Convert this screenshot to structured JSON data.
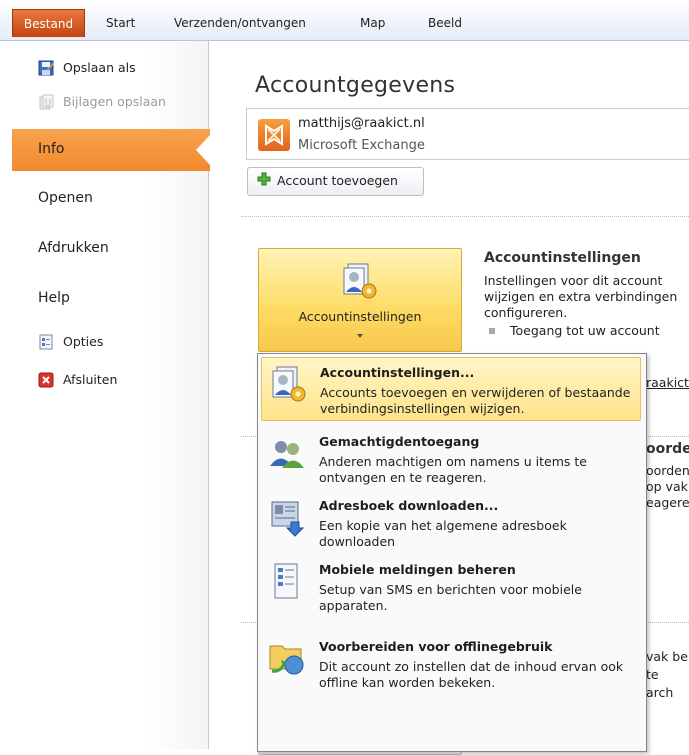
{
  "ribbon": {
    "tabs": [
      "Bestand",
      "Start",
      "Verzenden/ontvangen",
      "Map",
      "Beeld"
    ]
  },
  "backstage": {
    "save_as": "Opslaan als",
    "save_attachments": "Bijlagen opslaan",
    "info": "Info",
    "open": "Openen",
    "print": "Afdrukken",
    "help": "Help",
    "options": "Opties",
    "exit": "Afsluiten"
  },
  "main": {
    "title": "Accountgegevens",
    "account_email": "matthijs@raakict.nl",
    "account_type": "Microsoft Exchange",
    "add_account": "Account toevoegen",
    "settings_button": "Accountinstellingen",
    "section_title": "Accountinstellingen",
    "section_line1": "Instellingen voor dit account",
    "section_line2": "wijzigen en extra verbindingen",
    "section_line3": "configureren.",
    "section_bullet": "Toegang tot uw account",
    "partial_link": "raakict.",
    "partial_heading": "oorden",
    "partial_a": "oorden",
    "partial_b": "op vak",
    "partial_c": "eageren",
    "partial_d": "vak be",
    "partial_e": "te arch"
  },
  "menu": {
    "items": [
      {
        "title": "Accountinstellingen...",
        "desc": "Accounts toevoegen en verwijderen of bestaande verbindingsinstellingen wijzigen.",
        "icon": "account-settings-icon"
      },
      {
        "title": "Gemachtigdentoegang",
        "desc": "Anderen machtigen om namens u items te ontvangen en te reageren.",
        "icon": "delegate-access-icon"
      },
      {
        "title": "Adresboek downloaden...",
        "desc": "Een kopie van het algemene adresboek downloaden",
        "icon": "address-book-download-icon"
      },
      {
        "title": "Mobiele meldingen beheren",
        "desc": "Setup van SMS en berichten voor mobiele apparaten.",
        "icon": "mobile-notifications-icon"
      },
      {
        "title": "Voorbereiden voor offlinegebruik",
        "desc": "Dit account zo instellen dat de inhoud ervan ook offline kan worden bekeken.",
        "icon": "offline-use-icon"
      }
    ]
  },
  "colors": {
    "file_tab": "#d55a1f",
    "info_selected": "#f7972f",
    "menu_highlight": "#ffe38a"
  }
}
